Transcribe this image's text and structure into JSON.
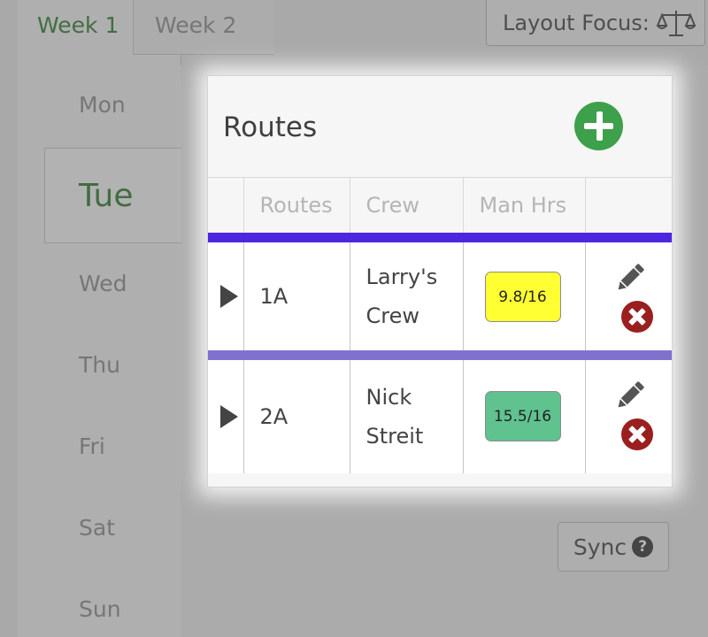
{
  "week_tabs": [
    {
      "label": "Week 1",
      "active": true
    },
    {
      "label": "Week 2",
      "active": false
    }
  ],
  "layout_focus": {
    "label": "Layout Focus:",
    "icon": "balance-scale-icon"
  },
  "days": [
    {
      "label": "Mon"
    },
    {
      "label": "Tue",
      "active": true
    },
    {
      "label": "Wed"
    },
    {
      "label": "Thu"
    },
    {
      "label": "Fri"
    },
    {
      "label": "Sat"
    },
    {
      "label": "Sun"
    }
  ],
  "sync": {
    "label": "Sync",
    "help_icon": "?"
  },
  "routes_panel": {
    "title": "Routes",
    "add_icon": "plus-circle-icon",
    "columns": [
      "",
      "Routes",
      "Crew",
      "Man Hrs",
      ""
    ],
    "rows": [
      {
        "route": "1A",
        "crew_line1": "Larry's",
        "crew_line2": "Crew",
        "man_hrs": "9.8/16",
        "status_color": "#ffff33",
        "bar_color": "#4c26e0"
      },
      {
        "route": "2A",
        "crew_line1": "Nick",
        "crew_line2": "Streit",
        "man_hrs": "15.5/16",
        "status_color": "#5fc28f",
        "bar_color": "#7f72cf"
      }
    ]
  },
  "colors": {
    "accent_green": "#2f7d2f",
    "add_green": "#3da04a",
    "delete_red": "#9a1f1f"
  }
}
